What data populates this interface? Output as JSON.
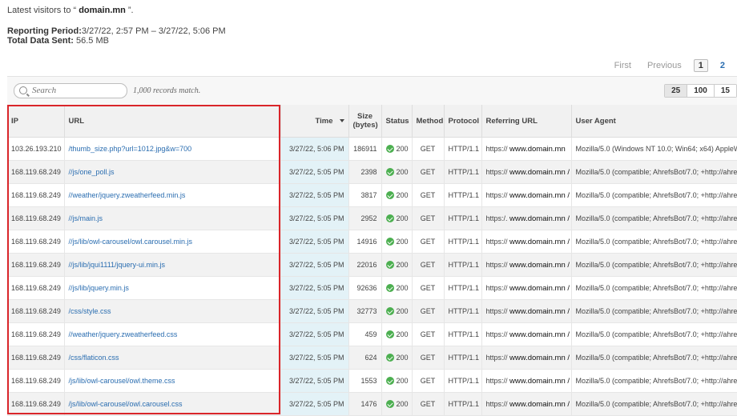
{
  "header": {
    "prefix": "Latest visitors to “",
    "domain": "domain.mn",
    "suffix": "”.",
    "period_label": "Reporting Period:",
    "period_value": "3/27/22, 2:57 PM – 3/27/22, 5:06 PM",
    "data_label": "Total Data Sent:",
    "data_value": "56.5 MB"
  },
  "pager": {
    "first": "First",
    "previous": "Previous",
    "page1": "1",
    "page2": "2"
  },
  "toolbar": {
    "search_placeholder": "Search",
    "records": "1,000 records match.",
    "pagesizes": [
      "25",
      "100",
      "15"
    ]
  },
  "columns": {
    "ip": "IP",
    "url": "URL",
    "time": "Time",
    "size_top": "Size",
    "size_bottom": "(bytes)",
    "status": "Status",
    "method": "Method",
    "protocol": "Protocol",
    "referring_url": "Referring URL",
    "user_agent": "User Agent"
  },
  "rows": [
    {
      "ip": "103.26.193.210",
      "url": "/thumb_size.php?url=1012.jpg&w=700",
      "time": "3/27/22, 5:06 PM",
      "size": "186911",
      "status": "200",
      "method": "GET",
      "protocol": "HTTP/1.1",
      "ref": "https://",
      "ref_domain": "www.domain.mn",
      "agent": "Mozilla/5.0 (Windows NT 10.0; Win64; x64) AppleWe"
    },
    {
      "ip": "168.119.68.249",
      "url": "//js/one_poll.js",
      "time": "3/27/22, 5:05 PM",
      "size": "2398",
      "status": "200",
      "method": "GET",
      "protocol": "HTTP/1.1",
      "ref": "https://",
      "ref_domain": "www.domain.mn /",
      "agent": "Mozilla/5.0 (compatible; AhrefsBot/7.0; +http://ahrefs."
    },
    {
      "ip": "168.119.68.249",
      "url": "//weather/jquery.zweatherfeed.min.js",
      "time": "3/27/22, 5:05 PM",
      "size": "3817",
      "status": "200",
      "method": "GET",
      "protocol": "HTTP/1.1",
      "ref": "https://",
      "ref_domain": "www.domain.mn /",
      "agent": "Mozilla/5.0 (compatible; AhrefsBot/7.0; +http://ahrefs."
    },
    {
      "ip": "168.119.68.249",
      "url": "//js/main.js",
      "time": "3/27/22, 5:05 PM",
      "size": "2952",
      "status": "200",
      "method": "GET",
      "protocol": "HTTP/1.1",
      "ref": "https:/.",
      "ref_domain": "www.domain.mn /",
      "agent": "Mozilla/5.0 (compatible; AhrefsBot/7.0; +http://ahrefs."
    },
    {
      "ip": "168.119.68.249",
      "url": "//js/lib/owl-carousel/owl.carousel.min.js",
      "time": "3/27/22, 5:05 PM",
      "size": "14916",
      "status": "200",
      "method": "GET",
      "protocol": "HTTP/1.1",
      "ref": "https://",
      "ref_domain": "www.domain.mn /",
      "agent": "Mozilla/5.0 (compatible; AhrefsBot/7.0; +http://ahrefs."
    },
    {
      "ip": "168.119.68.249",
      "url": "//js/lib/jqui1111/jquery-ui.min.js",
      "time": "3/27/22, 5:05 PM",
      "size": "22016",
      "status": "200",
      "method": "GET",
      "protocol": "HTTP/1.1",
      "ref": "https://",
      "ref_domain": "www.domain.mn /",
      "agent": "Mozilla/5.0 (compatible; AhrefsBot/7.0; +http://ahrefs."
    },
    {
      "ip": "168.119.68.249",
      "url": "//js/lib/jquery.min.js",
      "time": "3/27/22, 5:05 PM",
      "size": "92636",
      "status": "200",
      "method": "GET",
      "protocol": "HTTP/1.1",
      "ref": "https://",
      "ref_domain": "www.domain.mn /",
      "agent": "Mozilla/5.0 (compatible; AhrefsBot/7.0; +http://ahrefs."
    },
    {
      "ip": "168.119.68.249",
      "url": "/css/style.css",
      "time": "3/27/22, 5:05 PM",
      "size": "32773",
      "status": "200",
      "method": "GET",
      "protocol": "HTTP/1.1",
      "ref": "https://",
      "ref_domain": "www.domain.mn /",
      "agent": "Mozilla/5.0 (compatible; AhrefsBot/7.0; +http://ahrefs."
    },
    {
      "ip": "168.119.68.249",
      "url": "//weather/jquery.zweatherfeed.css",
      "time": "3/27/22, 5:05 PM",
      "size": "459",
      "status": "200",
      "method": "GET",
      "protocol": "HTTP/1.1",
      "ref": "https://",
      "ref_domain": "www.domain.mn /",
      "agent": "Mozilla/5.0 (compatible; AhrefsBot/7.0; +http://ahrefs."
    },
    {
      "ip": "168.119.68.249",
      "url": "/css/flaticon.css",
      "time": "3/27/22, 5:05 PM",
      "size": "624",
      "status": "200",
      "method": "GET",
      "protocol": "HTTP/1.1",
      "ref": "https://",
      "ref_domain": "www.domain.mn /",
      "agent": "Mozilla/5.0 (compatible; AhrefsBot/7.0; +http://ahrefs."
    },
    {
      "ip": "168.119.68.249",
      "url": "/js/lib/owl-carousel/owl.theme.css",
      "time": "3/27/22, 5:05 PM",
      "size": "1553",
      "status": "200",
      "method": "GET",
      "protocol": "HTTP/1.1",
      "ref": "https://",
      "ref_domain": "www.domain.mn /",
      "agent": "Mozilla/5.0 (compatible; AhrefsBot/7.0; +http://ahrefs."
    },
    {
      "ip": "168.119.68.249",
      "url": "/js/lib/owl-carousel/owl.carousel.css",
      "time": "3/27/22, 5:05 PM",
      "size": "1476",
      "status": "200",
      "method": "GET",
      "protocol": "HTTP/1.1",
      "ref": "https://",
      "ref_domain": "www.domain.mn /",
      "agent": "Mozilla/5.0 (compatible; AhrefsBot/7.0; +http://ahrefs."
    }
  ]
}
